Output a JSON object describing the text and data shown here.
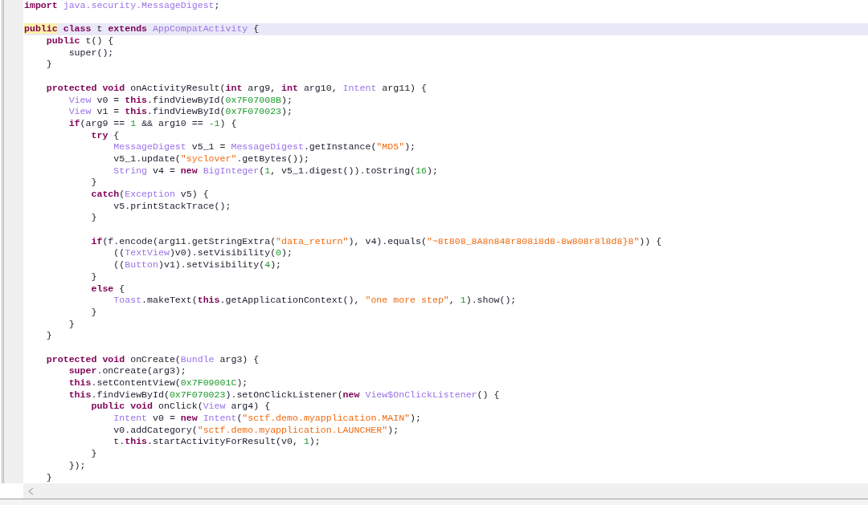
{
  "editor": {
    "lines": [
      {
        "kind": "code",
        "current": false,
        "tokens": [
          {
            "kind": "keyword",
            "text": "import"
          },
          {
            "kind": "type",
            "text": " java.security.MessageDigest"
          },
          {
            "kind": "plain",
            "text": ";"
          }
        ]
      },
      {
        "kind": "blank"
      },
      {
        "kind": "code",
        "current": true,
        "tokens": [
          {
            "kind": "occurrence",
            "text": "public"
          },
          {
            "kind": "keyword",
            "text": " class"
          },
          {
            "kind": "plain",
            "text": " t "
          },
          {
            "kind": "keyword",
            "text": "extends"
          },
          {
            "kind": "type",
            "text": " AppCompatActivity"
          },
          {
            "kind": "plain",
            "text": " {"
          }
        ]
      },
      {
        "kind": "code",
        "current": false,
        "tokens": [
          {
            "kind": "keyword",
            "text": "    public"
          },
          {
            "kind": "plain",
            "text": " t() {"
          }
        ]
      },
      {
        "kind": "code",
        "current": false,
        "tokens": [
          {
            "kind": "plain",
            "text": "        super();"
          }
        ]
      },
      {
        "kind": "code",
        "current": false,
        "tokens": [
          {
            "kind": "plain",
            "text": "    }"
          }
        ]
      },
      {
        "kind": "blank"
      },
      {
        "kind": "code",
        "current": false,
        "tokens": [
          {
            "kind": "keyword",
            "text": "    protected"
          },
          {
            "kind": "keyword",
            "text": " void"
          },
          {
            "kind": "plain",
            "text": " onActivityResult("
          },
          {
            "kind": "keyword",
            "text": "int"
          },
          {
            "kind": "plain",
            "text": " arg9, "
          },
          {
            "kind": "keyword",
            "text": "int"
          },
          {
            "kind": "plain",
            "text": " arg10, "
          },
          {
            "kind": "type",
            "text": "Intent"
          },
          {
            "kind": "plain",
            "text": " arg11) {"
          }
        ]
      },
      {
        "kind": "code",
        "current": false,
        "tokens": [
          {
            "kind": "type",
            "text": "        View"
          },
          {
            "kind": "plain",
            "text": " v0 = "
          },
          {
            "kind": "keyword",
            "text": "this"
          },
          {
            "kind": "plain",
            "text": ".findViewById("
          },
          {
            "kind": "number",
            "text": "0x7F07008B"
          },
          {
            "kind": "plain",
            "text": ");"
          }
        ]
      },
      {
        "kind": "code",
        "current": false,
        "tokens": [
          {
            "kind": "type",
            "text": "        View"
          },
          {
            "kind": "plain",
            "text": " v1 = "
          },
          {
            "kind": "keyword",
            "text": "this"
          },
          {
            "kind": "plain",
            "text": ".findViewById("
          },
          {
            "kind": "number",
            "text": "0x7F070023"
          },
          {
            "kind": "plain",
            "text": ");"
          }
        ]
      },
      {
        "kind": "code",
        "current": false,
        "tokens": [
          {
            "kind": "keyword",
            "text": "        if"
          },
          {
            "kind": "plain",
            "text": "(arg9 == "
          },
          {
            "kind": "number",
            "text": "1"
          },
          {
            "kind": "plain",
            "text": " && arg10 == "
          },
          {
            "kind": "number",
            "text": "-1"
          },
          {
            "kind": "plain",
            "text": ") {"
          }
        ]
      },
      {
        "kind": "code",
        "current": false,
        "tokens": [
          {
            "kind": "keyword",
            "text": "            try"
          },
          {
            "kind": "plain",
            "text": " {"
          }
        ]
      },
      {
        "kind": "code",
        "current": false,
        "tokens": [
          {
            "kind": "type",
            "text": "                MessageDigest"
          },
          {
            "kind": "plain",
            "text": " v5_1 = "
          },
          {
            "kind": "type",
            "text": "MessageDigest"
          },
          {
            "kind": "plain",
            "text": ".getInstance("
          },
          {
            "kind": "string",
            "text": "\"MD5\""
          },
          {
            "kind": "plain",
            "text": ");"
          }
        ]
      },
      {
        "kind": "code",
        "current": false,
        "tokens": [
          {
            "kind": "plain",
            "text": "                v5_1.update("
          },
          {
            "kind": "string",
            "text": "\"syclover\""
          },
          {
            "kind": "plain",
            "text": ".getBytes());"
          }
        ]
      },
      {
        "kind": "code",
        "current": false,
        "tokens": [
          {
            "kind": "type",
            "text": "                String"
          },
          {
            "kind": "plain",
            "text": " v4 = "
          },
          {
            "kind": "keyword",
            "text": "new"
          },
          {
            "kind": "type",
            "text": " BigInteger"
          },
          {
            "kind": "plain",
            "text": "("
          },
          {
            "kind": "number",
            "text": "1"
          },
          {
            "kind": "plain",
            "text": ", v5_1.digest()).toString("
          },
          {
            "kind": "number",
            "text": "16"
          },
          {
            "kind": "plain",
            "text": ");"
          }
        ]
      },
      {
        "kind": "code",
        "current": false,
        "tokens": [
          {
            "kind": "plain",
            "text": "            }"
          }
        ]
      },
      {
        "kind": "code",
        "current": false,
        "tokens": [
          {
            "kind": "keyword",
            "text": "            catch"
          },
          {
            "kind": "plain",
            "text": "("
          },
          {
            "kind": "type",
            "text": "Exception"
          },
          {
            "kind": "plain",
            "text": " v5) {"
          }
        ]
      },
      {
        "kind": "code",
        "current": false,
        "tokens": [
          {
            "kind": "plain",
            "text": "                v5.printStackTrace();"
          }
        ]
      },
      {
        "kind": "code",
        "current": false,
        "tokens": [
          {
            "kind": "plain",
            "text": "            }"
          }
        ]
      },
      {
        "kind": "blank"
      },
      {
        "kind": "code",
        "current": false,
        "tokens": [
          {
            "kind": "keyword",
            "text": "            if"
          },
          {
            "kind": "plain",
            "text": "(f.encode(arg11.getStringExtra("
          },
          {
            "kind": "string",
            "text": "\"data_return\""
          },
          {
            "kind": "plain",
            "text": "), v4).equals("
          },
          {
            "kind": "string",
            "text": "\"~8t808_8A8n848r808i8d8-8w808r8l8d8}8\""
          },
          {
            "kind": "plain",
            "text": ")) {"
          }
        ]
      },
      {
        "kind": "code",
        "current": false,
        "tokens": [
          {
            "kind": "plain",
            "text": "                (("
          },
          {
            "kind": "type",
            "text": "TextView"
          },
          {
            "kind": "plain",
            "text": ")v0).setVisibility("
          },
          {
            "kind": "number",
            "text": "0"
          },
          {
            "kind": "plain",
            "text": ");"
          }
        ]
      },
      {
        "kind": "code",
        "current": false,
        "tokens": [
          {
            "kind": "plain",
            "text": "                (("
          },
          {
            "kind": "type",
            "text": "Button"
          },
          {
            "kind": "plain",
            "text": ")v1).setVisibility("
          },
          {
            "kind": "number",
            "text": "4"
          },
          {
            "kind": "plain",
            "text": ");"
          }
        ]
      },
      {
        "kind": "code",
        "current": false,
        "tokens": [
          {
            "kind": "plain",
            "text": "            }"
          }
        ]
      },
      {
        "kind": "code",
        "current": false,
        "tokens": [
          {
            "kind": "keyword",
            "text": "            else"
          },
          {
            "kind": "plain",
            "text": " {"
          }
        ]
      },
      {
        "kind": "code",
        "current": false,
        "tokens": [
          {
            "kind": "type",
            "text": "                Toast"
          },
          {
            "kind": "plain",
            "text": ".makeText("
          },
          {
            "kind": "keyword",
            "text": "this"
          },
          {
            "kind": "plain",
            "text": ".getApplicationContext(), "
          },
          {
            "kind": "string",
            "text": "\"one more step\""
          },
          {
            "kind": "plain",
            "text": ", "
          },
          {
            "kind": "number",
            "text": "1"
          },
          {
            "kind": "plain",
            "text": ").show();"
          }
        ]
      },
      {
        "kind": "code",
        "current": false,
        "tokens": [
          {
            "kind": "plain",
            "text": "            }"
          }
        ]
      },
      {
        "kind": "code",
        "current": false,
        "tokens": [
          {
            "kind": "plain",
            "text": "        }"
          }
        ]
      },
      {
        "kind": "code",
        "current": false,
        "tokens": [
          {
            "kind": "plain",
            "text": "    }"
          }
        ]
      },
      {
        "kind": "blank"
      },
      {
        "kind": "code",
        "current": false,
        "tokens": [
          {
            "kind": "keyword",
            "text": "    protected"
          },
          {
            "kind": "keyword",
            "text": " void"
          },
          {
            "kind": "plain",
            "text": " onCreate("
          },
          {
            "kind": "type",
            "text": "Bundle"
          },
          {
            "kind": "plain",
            "text": " arg3) {"
          }
        ]
      },
      {
        "kind": "code",
        "current": false,
        "tokens": [
          {
            "kind": "keyword",
            "text": "        super"
          },
          {
            "kind": "plain",
            "text": ".onCreate(arg3);"
          }
        ]
      },
      {
        "kind": "code",
        "current": false,
        "tokens": [
          {
            "kind": "keyword",
            "text": "        this"
          },
          {
            "kind": "plain",
            "text": ".setContentView("
          },
          {
            "kind": "number",
            "text": "0x7F09001C"
          },
          {
            "kind": "plain",
            "text": ");"
          }
        ]
      },
      {
        "kind": "code",
        "current": false,
        "tokens": [
          {
            "kind": "keyword",
            "text": "        this"
          },
          {
            "kind": "plain",
            "text": ".findViewById("
          },
          {
            "kind": "number",
            "text": "0x7F070023"
          },
          {
            "kind": "plain",
            "text": ").setOnClickListener("
          },
          {
            "kind": "keyword",
            "text": "new"
          },
          {
            "kind": "type",
            "text": " View$OnClickListener"
          },
          {
            "kind": "plain",
            "text": "() {"
          }
        ]
      },
      {
        "kind": "code",
        "current": false,
        "tokens": [
          {
            "kind": "keyword",
            "text": "            public"
          },
          {
            "kind": "keyword",
            "text": " void"
          },
          {
            "kind": "plain",
            "text": " onClick("
          },
          {
            "kind": "type",
            "text": "View"
          },
          {
            "kind": "plain",
            "text": " arg4) {"
          }
        ]
      },
      {
        "kind": "code",
        "current": false,
        "tokens": [
          {
            "kind": "type",
            "text": "                Intent"
          },
          {
            "kind": "plain",
            "text": " v0 = "
          },
          {
            "kind": "keyword",
            "text": "new"
          },
          {
            "kind": "type",
            "text": " Intent"
          },
          {
            "kind": "plain",
            "text": "("
          },
          {
            "kind": "string",
            "text": "\"sctf.demo.myapplication.MAIN\""
          },
          {
            "kind": "plain",
            "text": ");"
          }
        ]
      },
      {
        "kind": "code",
        "current": false,
        "tokens": [
          {
            "kind": "plain",
            "text": "                v0.addCategory("
          },
          {
            "kind": "string",
            "text": "\"sctf.demo.myapplication.LAUNCHER\""
          },
          {
            "kind": "plain",
            "text": ");"
          }
        ]
      },
      {
        "kind": "code",
        "current": false,
        "tokens": [
          {
            "kind": "plain",
            "text": "                t."
          },
          {
            "kind": "keyword",
            "text": "this"
          },
          {
            "kind": "plain",
            "text": ".startActivityForResult(v0, "
          },
          {
            "kind": "number",
            "text": "1"
          },
          {
            "kind": "plain",
            "text": ");"
          }
        ]
      },
      {
        "kind": "code",
        "current": false,
        "tokens": [
          {
            "kind": "plain",
            "text": "            }"
          }
        ]
      },
      {
        "kind": "code",
        "current": false,
        "tokens": [
          {
            "kind": "plain",
            "text": "        });"
          }
        ]
      },
      {
        "kind": "code",
        "current": false,
        "tokens": [
          {
            "kind": "plain",
            "text": "    }"
          }
        ]
      }
    ]
  }
}
